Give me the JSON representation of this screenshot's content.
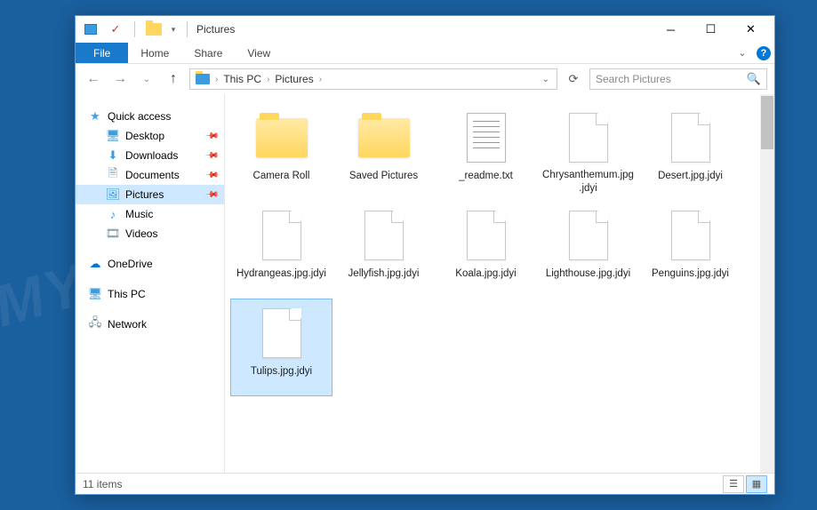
{
  "title": "Pictures",
  "menu": {
    "file": "File",
    "tabs": [
      "Home",
      "Share",
      "View"
    ]
  },
  "breadcrumb": [
    "This PC",
    "Pictures"
  ],
  "search_placeholder": "Search Pictures",
  "sidebar": {
    "quick_access": {
      "label": "Quick access",
      "children": [
        {
          "label": "Desktop",
          "icon": "desktop",
          "pinned": true
        },
        {
          "label": "Downloads",
          "icon": "downloads",
          "pinned": true
        },
        {
          "label": "Documents",
          "icon": "documents",
          "pinned": true
        },
        {
          "label": "Pictures",
          "icon": "pictures",
          "pinned": true,
          "selected": true
        },
        {
          "label": "Music",
          "icon": "music",
          "pinned": false
        },
        {
          "label": "Videos",
          "icon": "videos",
          "pinned": false
        }
      ]
    },
    "onedrive": {
      "label": "OneDrive"
    },
    "thispc": {
      "label": "This PC"
    },
    "network": {
      "label": "Network"
    }
  },
  "items": [
    {
      "name": "Camera Roll",
      "type": "folder"
    },
    {
      "name": "Saved Pictures",
      "type": "folder"
    },
    {
      "name": "_readme.txt",
      "type": "text"
    },
    {
      "name": "Chrysanthemum.jpg.jdyi",
      "type": "file"
    },
    {
      "name": "Desert.jpg.jdyi",
      "type": "file"
    },
    {
      "name": "Hydrangeas.jpg.jdyi",
      "type": "file"
    },
    {
      "name": "Jellyfish.jpg.jdyi",
      "type": "file"
    },
    {
      "name": "Koala.jpg.jdyi",
      "type": "file"
    },
    {
      "name": "Lighthouse.jpg.jdyi",
      "type": "file"
    },
    {
      "name": "Penguins.jpg.jdyi",
      "type": "file"
    },
    {
      "name": "Tulips.jpg.jdyi",
      "type": "file",
      "selected": true
    }
  ],
  "status": {
    "count_label": "11 items"
  },
  "watermark": "MYANTISPYWARE.COM"
}
